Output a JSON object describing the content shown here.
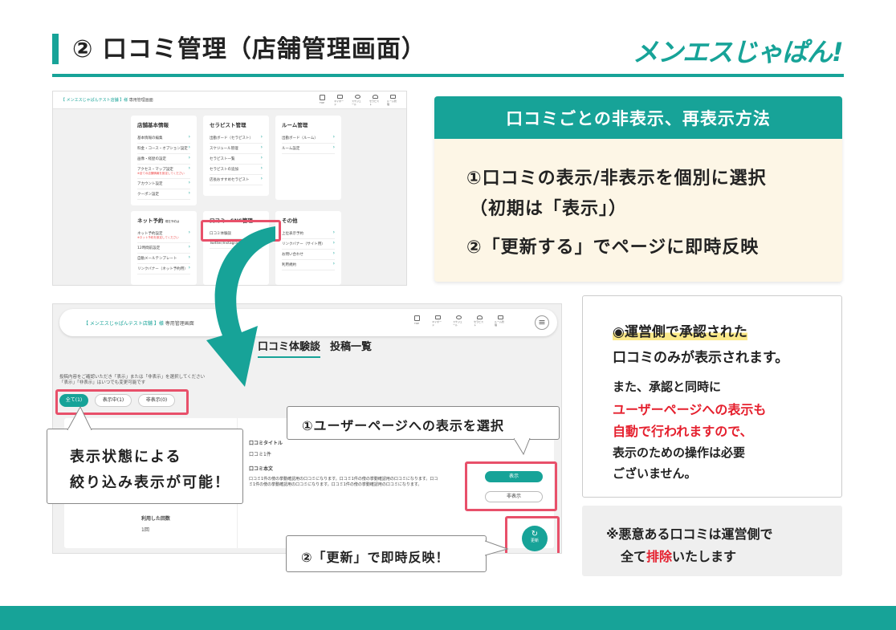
{
  "header": {
    "title": "② 口コミ管理（店舗管理画面）",
    "brand": "メンエスじゃぱん!"
  },
  "info_panel": {
    "heading": "口コミごとの非表示、再表示方法",
    "step1_line1": "①口コミの表示/非表示を個別に選択",
    "step1_line2": "（初期は「表示」）",
    "step2": "②「更新する」でページに即時反映"
  },
  "note": {
    "line1": "◉運営側で承認された",
    "line2": "口コミのみが表示されます。",
    "line3": "また、承認と同時に",
    "line4_red": "ユーザーページへの表示も",
    "line5_red": "自動で行われますので、",
    "line6": "表示のための操作は必要",
    "line7": "ございません。"
  },
  "warning": {
    "line1": "※悪意ある口コミは運営側で",
    "line2_pre": "全て",
    "line2_red": "排除",
    "line2_post": "いたします"
  },
  "screenshot1": {
    "breadcrumb_store": "【 メンエスじゃぱんテスト店舗 】様",
    "breadcrumb_page": "専用管理画面",
    "nav": [
      "TOP",
      "マイボード",
      "スケジュール",
      "セラピスト",
      "ルーム管理"
    ],
    "cards": {
      "store": {
        "title": "店舗基本情報",
        "items": [
          "基本情報の編集",
          "料金・コース・オプション設定",
          "画像・経歴の設定",
          "アクセス・マップ設定",
          "アカウント設定",
          "クーポン設定"
        ],
        "access_sub": "※全ての店舗情報を設定してください"
      },
      "therapist": {
        "title": "セラピスト管理",
        "items": [
          "出勤ボード（セラピスト）",
          "スケジュール管理",
          "セラピスト一覧",
          "セラピストの追加",
          "店長おすすめセラピスト"
        ]
      },
      "room": {
        "title": "ルーム管理",
        "items": [
          "出勤ボード（ルーム）",
          "ルーム設定"
        ]
      },
      "net": {
        "title": "ネット予約",
        "note": "現在予約は",
        "items": [
          "ネット予約設定",
          "12時間前設定",
          "自動メールテンプレート",
          "リンクバナー（ネット予約用）"
        ],
        "item_sub": "※ネット予約を設定してください"
      },
      "review": {
        "title": "口コミ・SNS管理",
        "items": [
          "口コミ体験談",
          "Twitter/Instagram"
        ]
      },
      "other": {
        "title": "その他",
        "items": [
          "上位表示予約",
          "リンクバナー（サイト用）",
          "お問い合わせ",
          "利用規約"
        ]
      }
    }
  },
  "screenshot2": {
    "breadcrumb_store": "【 メンエスじゃぱんテスト店舗 】様",
    "breadcrumb_page": "専用管理画面",
    "nav": [
      "TOP",
      "マイボード",
      "スケジュール",
      "セラピスト",
      "ルーム管理"
    ],
    "tab_active": "口コミ体験談",
    "tab_other": "投稿一覧",
    "desc_line1": "投稿内容をご確認いただき「表示」または「非表示」を選択してください",
    "desc_line2": "「表示」「非表示」はいつでも変更可能です",
    "filters": [
      "全て(1)",
      "表示中(1)",
      "非表示(0)"
    ],
    "review_title_label": "口コミタイトル",
    "review_title": "口コミ1件",
    "review_body_label": "口コミ本文",
    "review_body_1": "口コミ1件の傍の挙動確認用の口コミになります。口コミ1件の傍の挙動確認用の口コミになります。口コ",
    "review_body_2": "ミ1件の傍の挙動確認用の口コミになります。口コミ1件の傍の挙動確認用の口コミになります。",
    "count_label": "利用した回数",
    "count_value": "1回",
    "btn_show": "表示",
    "btn_hide": "非表示",
    "btn_update": "更新"
  },
  "callouts": {
    "filter": [
      "表示状態による",
      "絞り込み表示が可能！"
    ],
    "select": "①ユーザーページへの表示を選択",
    "update": "②「更新」で即時反映！"
  },
  "colors": {
    "teal": "#17a398",
    "highlight": "#e8506a",
    "red": "#e5202e",
    "cream": "#fdf6e6"
  }
}
